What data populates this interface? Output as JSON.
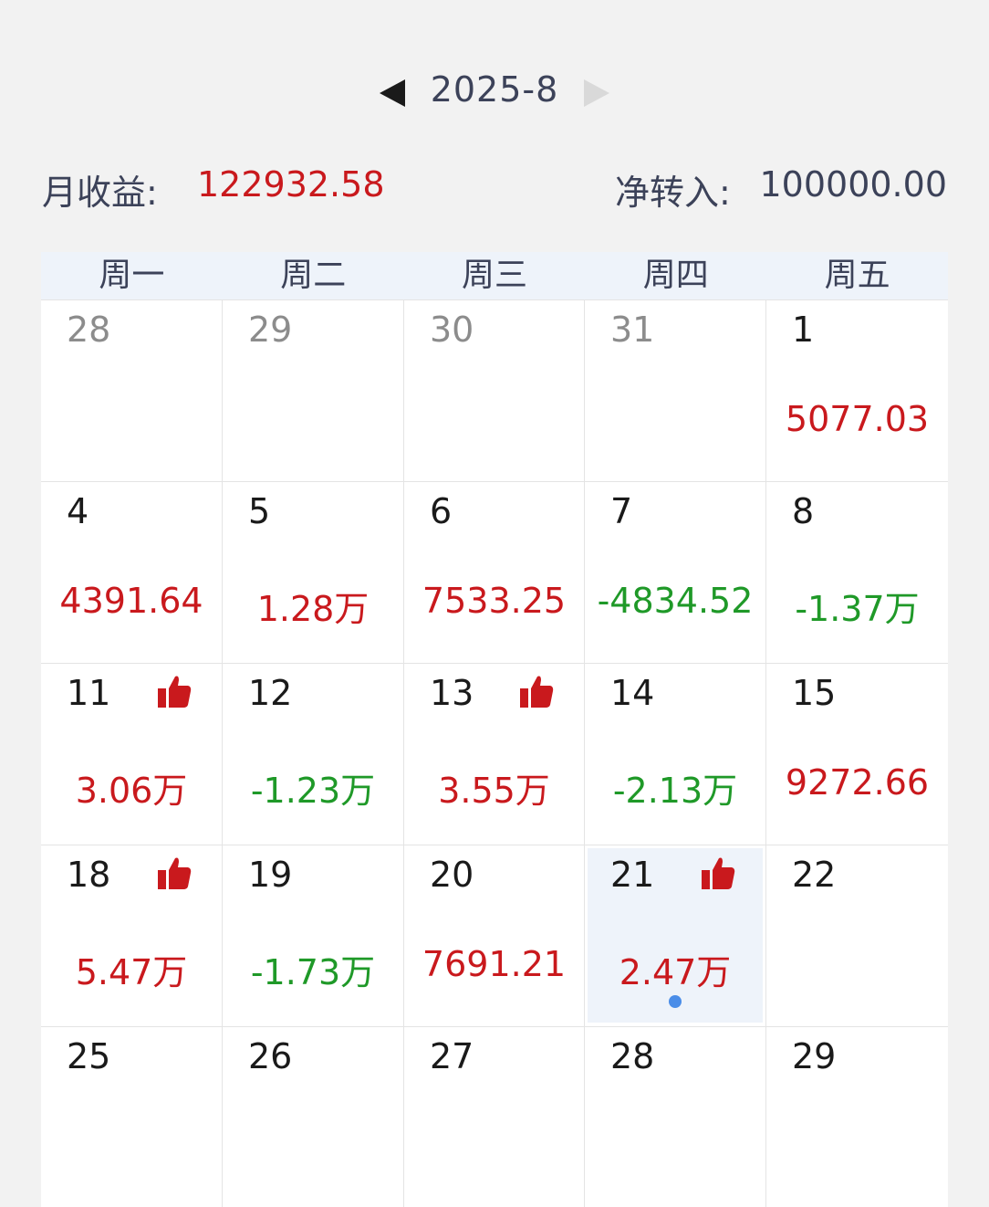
{
  "header": {
    "month": "2025-8",
    "prev_icon": "triangle-left-icon",
    "next_icon": "triangle-right-icon"
  },
  "summary": {
    "monthly_income_label": "月收益:",
    "monthly_income_value": "122932.58",
    "net_transfer_label": "净转入:",
    "net_transfer_value": "100000.00"
  },
  "colors": {
    "gain": "#c9191d",
    "loss": "#1f9928",
    "weekday_header_bg": "#eef3fa",
    "selected_day_bg": "#eef3fa",
    "today_dot": "#4a8de8"
  },
  "weekdays": [
    "周一",
    "周二",
    "周三",
    "周四",
    "周五"
  ],
  "days": [
    {
      "day": "28",
      "other_month": true
    },
    {
      "day": "29",
      "other_month": true
    },
    {
      "day": "30",
      "other_month": true
    },
    {
      "day": "31",
      "other_month": true
    },
    {
      "day": "1",
      "pnl": "5077.03",
      "trend": "up"
    },
    {
      "day": "4",
      "pnl": "4391.64",
      "trend": "up"
    },
    {
      "day": "5",
      "pnl": "1.28万",
      "trend": "up"
    },
    {
      "day": "6",
      "pnl": "7533.25",
      "trend": "up"
    },
    {
      "day": "7",
      "pnl": "-4834.52",
      "trend": "down"
    },
    {
      "day": "8",
      "pnl": "-1.37万",
      "trend": "down"
    },
    {
      "day": "11",
      "pnl": "3.06万",
      "trend": "up",
      "badge": "thumbs-up-icon"
    },
    {
      "day": "12",
      "pnl": "-1.23万",
      "trend": "down"
    },
    {
      "day": "13",
      "pnl": "3.55万",
      "trend": "up",
      "badge": "thumbs-up-icon"
    },
    {
      "day": "14",
      "pnl": "-2.13万",
      "trend": "down"
    },
    {
      "day": "15",
      "pnl": "9272.66",
      "trend": "up"
    },
    {
      "day": "18",
      "pnl": "5.47万",
      "trend": "up",
      "badge": "thumbs-up-icon"
    },
    {
      "day": "19",
      "pnl": "-1.73万",
      "trend": "down"
    },
    {
      "day": "20",
      "pnl": "7691.21",
      "trend": "up"
    },
    {
      "day": "21",
      "pnl": "2.47万",
      "trend": "up",
      "badge": "thumbs-up-icon",
      "selected": true,
      "today": true
    },
    {
      "day": "22"
    },
    {
      "day": "25"
    },
    {
      "day": "26"
    },
    {
      "day": "27"
    },
    {
      "day": "28"
    },
    {
      "day": "29"
    }
  ]
}
